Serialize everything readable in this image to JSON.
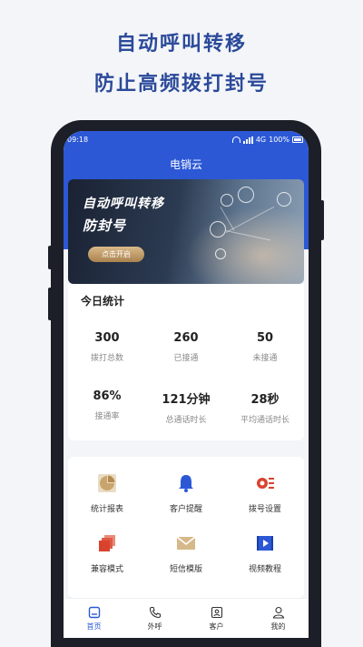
{
  "promo": {
    "line1": "自动呼叫转移",
    "line2": "防止高频拨打封号"
  },
  "status": {
    "time": "09:18",
    "network": "4G",
    "battery": "100%"
  },
  "app": {
    "title": "电销云"
  },
  "banner": {
    "title": "自动呼叫转移",
    "subtitle": "防封号",
    "button": "点击开启"
  },
  "stats": {
    "title": "今日统计",
    "items": [
      {
        "value": "300",
        "label": "拨打总数"
      },
      {
        "value": "260",
        "label": "已接通"
      },
      {
        "value": "50",
        "label": "未接通"
      },
      {
        "value": "86%",
        "label": "接通率"
      },
      {
        "value": "121分钟",
        "label": "总通话时长"
      },
      {
        "value": "28秒",
        "label": "平均通话时长"
      }
    ]
  },
  "tools": [
    {
      "label": "统计报表",
      "icon": "pie-chart-icon"
    },
    {
      "label": "客户提醒",
      "icon": "bell-icon"
    },
    {
      "label": "拨号设置",
      "icon": "gear-icon"
    },
    {
      "label": "兼容模式",
      "icon": "layers-icon"
    },
    {
      "label": "短信模版",
      "icon": "envelope-icon"
    },
    {
      "label": "视频教程",
      "icon": "video-icon"
    }
  ],
  "tabs": [
    {
      "label": "首页",
      "icon": "home-icon",
      "active": true
    },
    {
      "label": "外呼",
      "icon": "phone-icon",
      "active": false
    },
    {
      "label": "客户",
      "icon": "contact-card-icon",
      "active": false
    },
    {
      "label": "我的",
      "icon": "user-icon",
      "active": false
    }
  ],
  "colors": {
    "primary": "#2c58d6",
    "headline": "#2b4a9a",
    "gold": "#c9a56e",
    "red": "#d9432e"
  }
}
